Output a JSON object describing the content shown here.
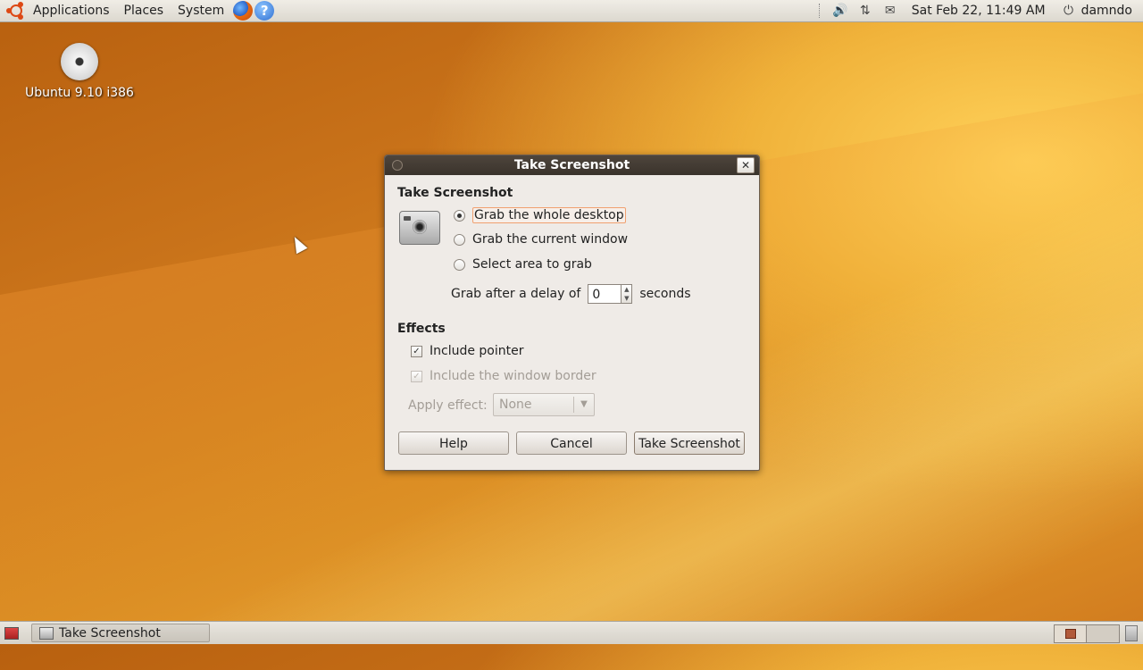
{
  "top_panel": {
    "menus": [
      "Applications",
      "Places",
      "System"
    ],
    "clock": "Sat Feb 22, 11:49 AM",
    "user": "damndo",
    "help_glyph": "?"
  },
  "desktop": {
    "icons": [
      {
        "label": "Ubuntu 9.10 i386",
        "icon": "cd-icon"
      }
    ]
  },
  "dialog": {
    "title": "Take Screenshot",
    "close_glyph": "✕",
    "section_capture": "Take Screenshot",
    "options": [
      {
        "label": "Grab the whole desktop",
        "checked": true
      },
      {
        "label": "Grab the current window",
        "checked": false
      },
      {
        "label": "Select area to grab",
        "checked": false
      }
    ],
    "delay": {
      "label": "Grab after a delay of",
      "value": "0",
      "unit": "seconds"
    },
    "section_effects": "Effects",
    "effects": [
      {
        "label": "Include pointer",
        "checked": true,
        "enabled": true
      },
      {
        "label": "Include the window border",
        "checked": true,
        "enabled": false
      }
    ],
    "apply_effect": {
      "label": "Apply effect:",
      "value": "None"
    },
    "buttons": {
      "help": "Help",
      "cancel": "Cancel",
      "take": "Take Screenshot"
    }
  },
  "bottom_panel": {
    "tasks": [
      {
        "label": "Take Screenshot"
      }
    ]
  }
}
